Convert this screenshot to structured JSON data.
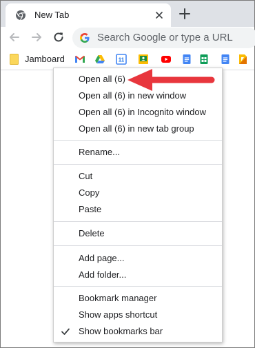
{
  "tab": {
    "title": "New Tab"
  },
  "omnibox": {
    "placeholder": "Search Google or type a URL"
  },
  "bookmarks_bar": {
    "folder_label": "Jamboard",
    "icons": [
      "gmail-icon",
      "google-drive-icon",
      "google-calendar-icon",
      "google-classroom-icon",
      "youtube-icon",
      "google-docs-icon",
      "google-sheets-icon",
      "google-docs-icon",
      "google-keep-icon"
    ],
    "calendar_day": "11"
  },
  "context_menu": {
    "group1": [
      "Open all (6)",
      "Open all (6) in new window",
      "Open all (6) in Incognito window",
      "Open all (6) in new tab group"
    ],
    "group2": [
      "Rename..."
    ],
    "group3": [
      "Cut",
      "Copy",
      "Paste"
    ],
    "group4": [
      "Delete"
    ],
    "group5": [
      "Add page...",
      "Add folder..."
    ],
    "group6": [
      "Bookmark manager",
      "Show apps shortcut",
      "Show bookmarks bar"
    ],
    "checked_item": "Show bookmarks bar"
  },
  "colors": {
    "annotation_arrow": "#e8363d",
    "tabstrip": "#dee1e6",
    "omnibox_bg": "#f1f3f4"
  }
}
